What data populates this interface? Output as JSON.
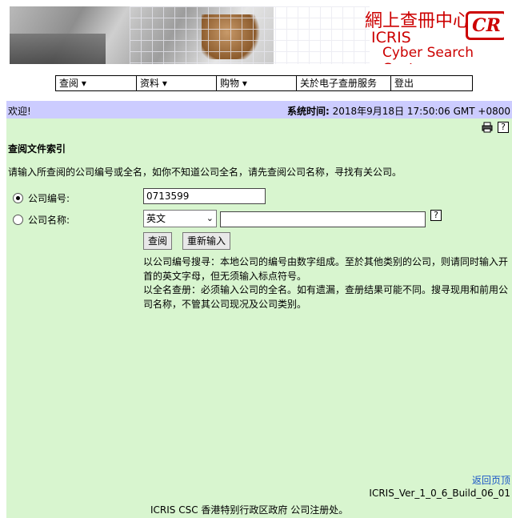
{
  "banner": {
    "title_cn": "網上查冊中心",
    "title_icris": "ICRIS",
    "title_csc": "Cyber Search Centre",
    "logo": "CR"
  },
  "menu": [
    {
      "label": "查阅 ▾"
    },
    {
      "label": "资料 ▾"
    },
    {
      "label": "购物 ▾"
    },
    {
      "label": "关於电子查册服务"
    },
    {
      "label": "登出"
    }
  ],
  "header": {
    "welcome": "欢迎!",
    "systime_label": "系统时间:",
    "systime_value": " 2018年9月18日 17:50:06 GMT +0800"
  },
  "icons": {
    "print": "printer-icon",
    "help": "help-icon"
  },
  "form": {
    "section_title": "查阅文件索引",
    "instruction": "请输入所查阅的公司编号或全名，如你不知道公司全名，请先查阅公司名称，寻找有关公司。",
    "company_no_label": "公司编号:",
    "company_no_value": "0713599",
    "company_name_label": "公司名称:",
    "language_value": "英文",
    "search_label": "查阅",
    "reset_label": "重新输入",
    "note1": "以公司编号搜寻：本地公司的编号由数字组成。至於其他类别的公司，则请同时输入开首的英文字母，但无须输入标点符号。",
    "note2": "以全名查册：必须输入公司的全名。如有遗漏，查册结果可能不同。搜寻现用和前用公司名称，不管其公司现况及公司类别。"
  },
  "footer": {
    "back": "返回页顶",
    "version": "ICRIS_Ver_1_0_6_Build_06_01",
    "org": "ICRIS CSC 香港特别行政区政府 公司注册处。"
  }
}
